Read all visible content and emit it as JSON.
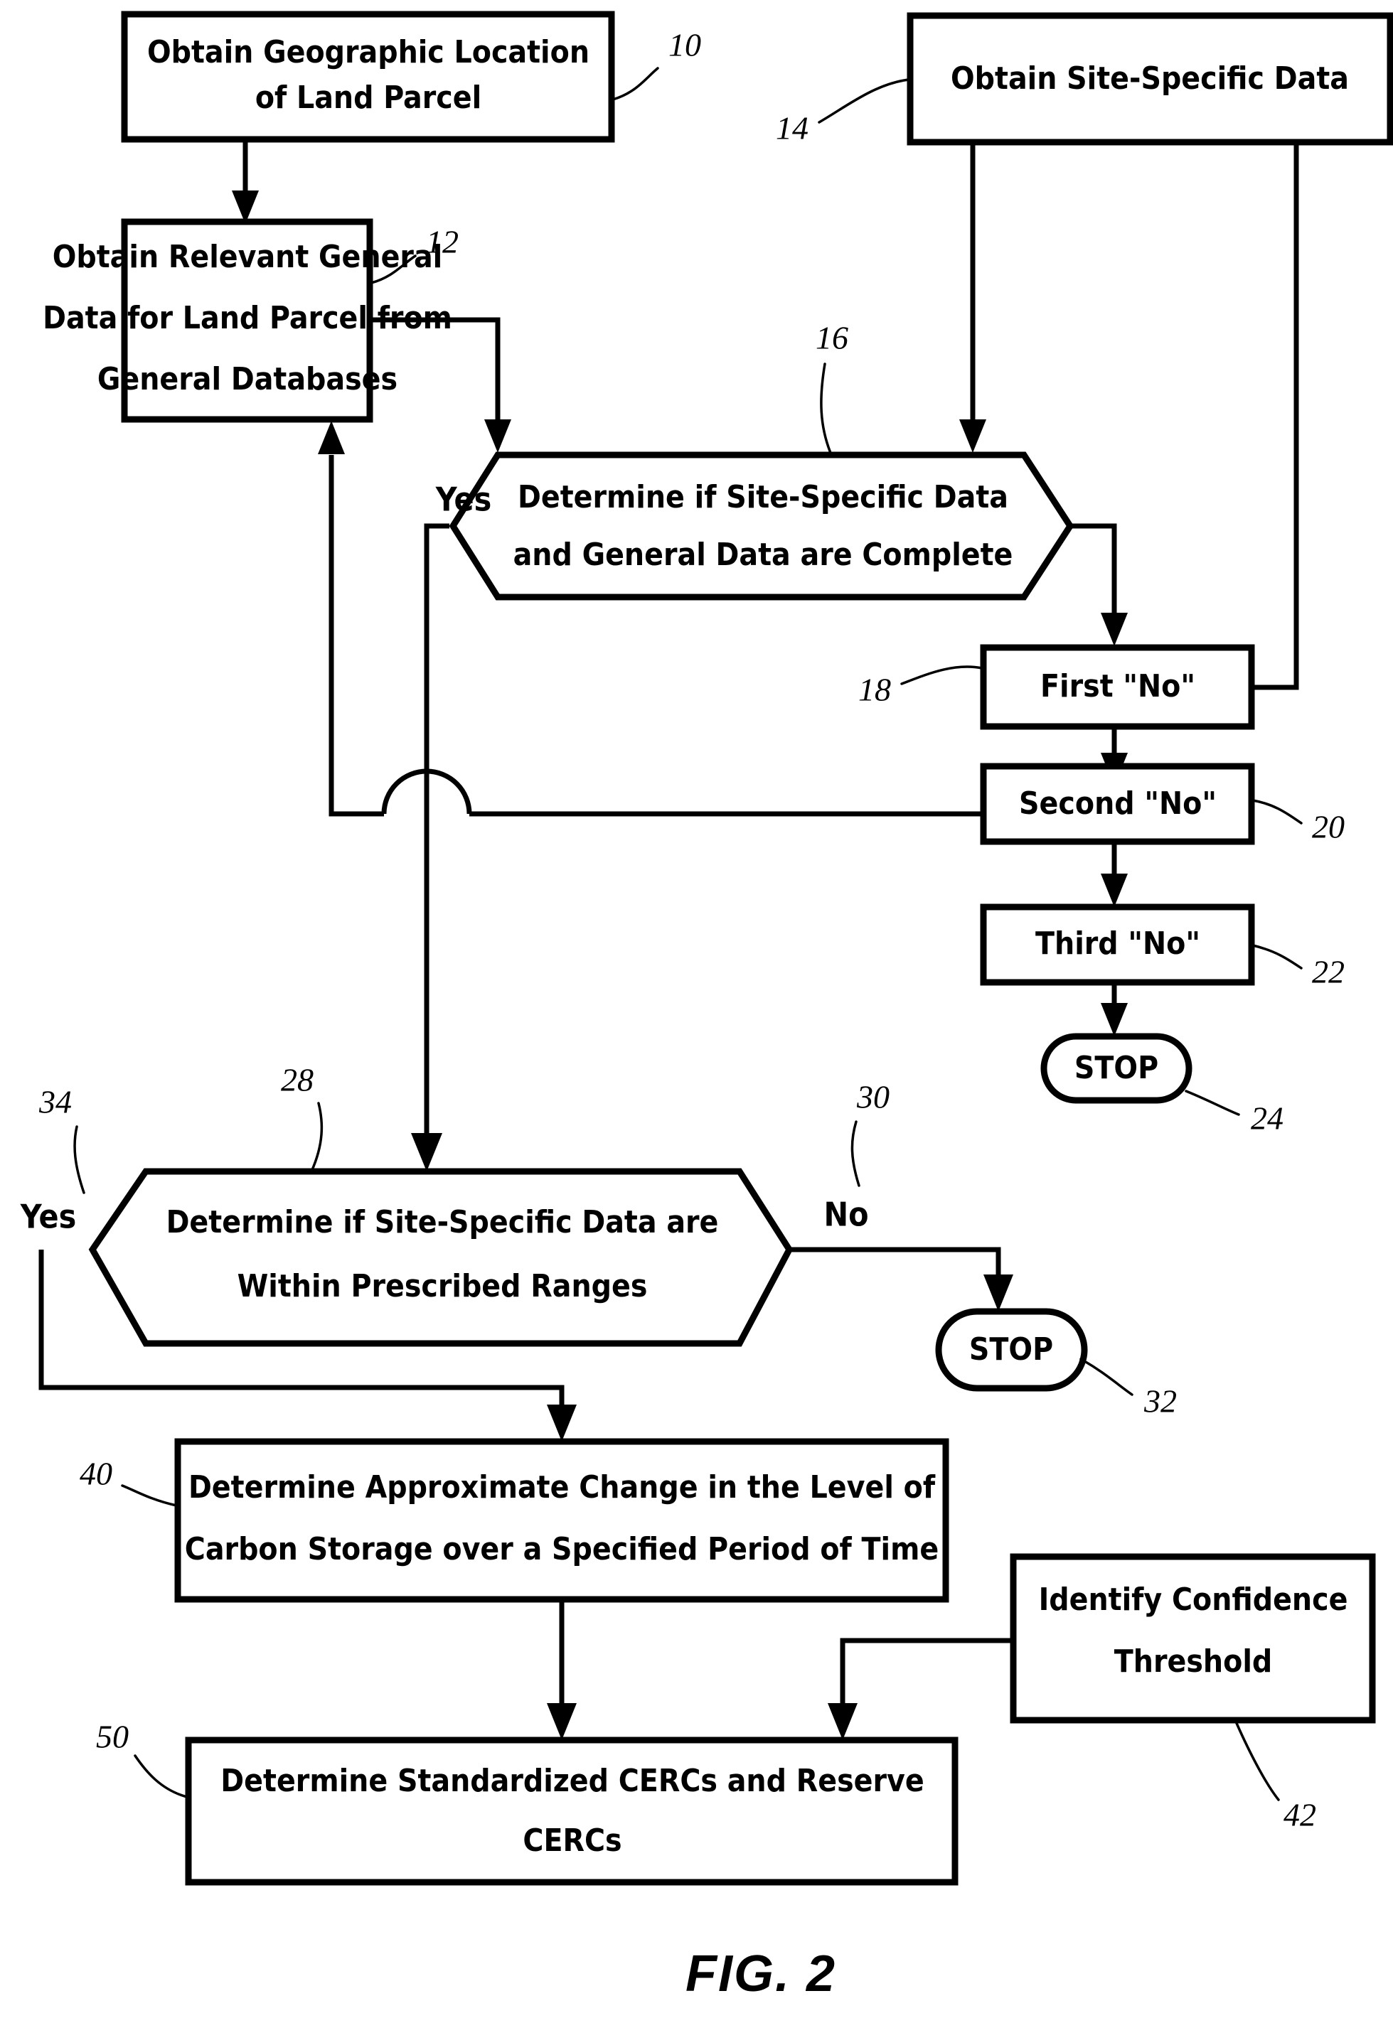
{
  "figure": {
    "caption": "FIG. 2",
    "type": "process-flowchart"
  },
  "nodes": {
    "n10": {
      "ref": "10",
      "shape": "process-box",
      "lines": [
        "Obtain Geographic Location",
        "of Land Parcel"
      ]
    },
    "n12": {
      "ref": "12",
      "shape": "process-box",
      "lines": [
        "Obtain Relevant General",
        "Data for Land Parcel from",
        "General Databases"
      ]
    },
    "n14": {
      "ref": "14",
      "shape": "process-box",
      "lines": [
        "Obtain Site-Specific Data"
      ]
    },
    "n16": {
      "ref": "16",
      "shape": "decision-hexagon",
      "lines": [
        "Determine if Site-Specific Data",
        "and General Data are Complete"
      ]
    },
    "n18": {
      "ref": "18",
      "shape": "process-box",
      "lines": [
        "First \"No\""
      ]
    },
    "n20": {
      "ref": "20",
      "shape": "process-box",
      "lines": [
        "Second \"No\""
      ]
    },
    "n22": {
      "ref": "22",
      "shape": "process-box",
      "lines": [
        "Third \"No\""
      ]
    },
    "n24": {
      "ref": "24",
      "shape": "terminator-stadium",
      "lines": [
        "STOP"
      ]
    },
    "n28": {
      "ref": "28",
      "shape": "decision-hexagon",
      "lines": [
        "Determine if Site-Specific Data are",
        "Within Prescribed Ranges"
      ]
    },
    "n32": {
      "ref": "32",
      "shape": "terminator-stadium",
      "lines": [
        "STOP"
      ]
    },
    "n40": {
      "ref": "40",
      "shape": "process-box",
      "lines": [
        "Determine Approximate Change in the Level of",
        "Carbon Storage over a Specified Period of Time"
      ]
    },
    "n42": {
      "ref": "42",
      "shape": "process-box",
      "lines": [
        "Identify Confidence",
        "Threshold"
      ]
    },
    "n50": {
      "ref": "50",
      "shape": "process-box",
      "lines": [
        "Determine Standardized CERCs and Reserve",
        "CERCs"
      ]
    }
  },
  "branch_labels": {
    "yes_16": "Yes",
    "yes_28": "Yes",
    "no_28": "No"
  },
  "branch_refs": {
    "yes_28_ref": "34",
    "no_28_ref": "30"
  },
  "colors": {
    "ink": "#000000",
    "paper": "#ffffff"
  }
}
